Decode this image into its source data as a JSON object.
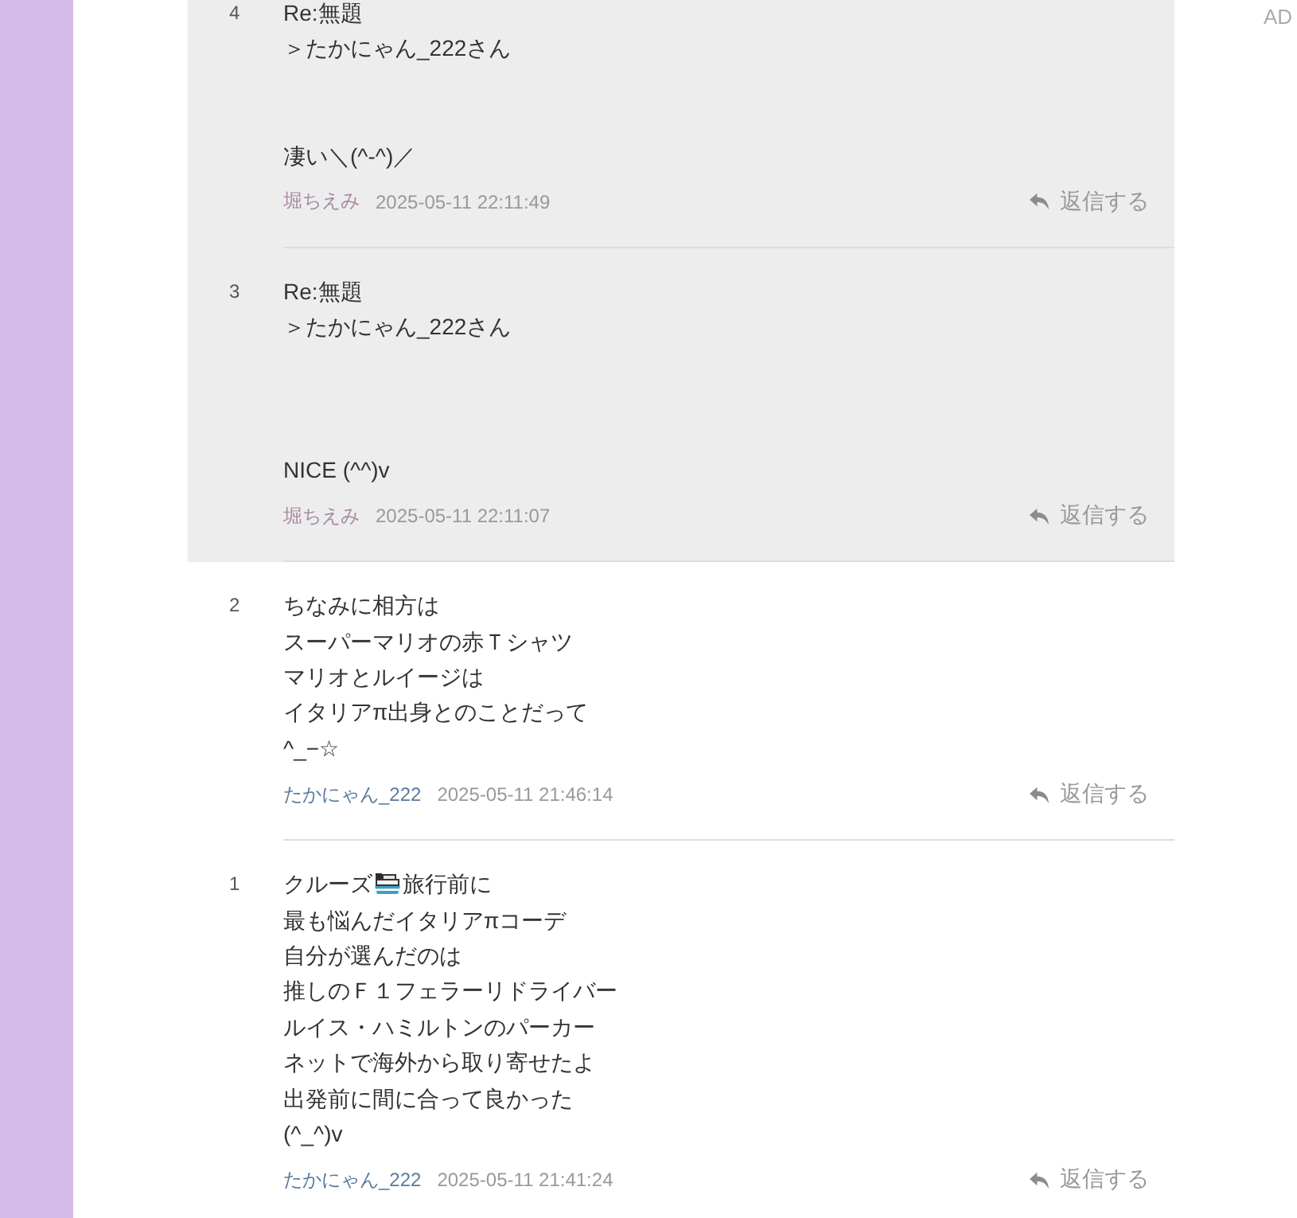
{
  "ad_label": "AD",
  "comments": [
    {
      "number": "4",
      "highlighted": true,
      "lines": [
        {
          "kind": "text",
          "text": "Re:無題"
        },
        {
          "kind": "text",
          "text": "＞たかにゃん_222さん"
        },
        {
          "kind": "blank"
        },
        {
          "kind": "blank"
        },
        {
          "kind": "text",
          "text": "凄い＼(^-^)／"
        }
      ],
      "author": "堀ちえみ",
      "color": "#a98aa3",
      "date": "2025-05-11 22:11:49",
      "reply": "返信する"
    },
    {
      "number": "3",
      "highlighted": true,
      "lines": [
        {
          "kind": "text",
          "text": "Re:無題"
        },
        {
          "kind": "text",
          "text": "＞たかにゃん_222さん"
        },
        {
          "kind": "blank"
        },
        {
          "kind": "blank"
        },
        {
          "kind": "blank"
        },
        {
          "kind": "text",
          "text": "NICE (^^)v"
        }
      ],
      "author": "堀ちえみ",
      "color": "#a98aa3",
      "date": "2025-05-11 22:11:07",
      "reply": "返信する"
    },
    {
      "number": "2",
      "highlighted": false,
      "lines": [
        {
          "kind": "text",
          "text": "ちなみに相方は"
        },
        {
          "kind": "text",
          "text": "スーパーマリオの赤Ｔシャツ"
        },
        {
          "kind": "text",
          "text": "マリオとルイージは"
        },
        {
          "kind": "text",
          "text": "イタリアπ出身とのことだって"
        },
        {
          "kind": "text",
          "text": "^_−☆"
        }
      ],
      "author": "たかにゃん_222",
      "color": "#557a9c",
      "date": "2025-05-11 21:46:14",
      "reply": "返信する"
    },
    {
      "number": "1",
      "highlighted": false,
      "lines": [
        {
          "kind": "emoji",
          "before": "クルーズ",
          "after": "旅行前に"
        },
        {
          "kind": "text",
          "text": "最も悩んだイタリアπコーデ"
        },
        {
          "kind": "text",
          "text": "自分が選んだのは"
        },
        {
          "kind": "text",
          "text": "推しのＦ１フェラーリドライバー"
        },
        {
          "kind": "text",
          "text": "ルイス・ハミルトンのパーカー"
        },
        {
          "kind": "text",
          "text": "ネットで海外から取り寄せたよ"
        },
        {
          "kind": "text",
          "text": "出発前に間に合って良かった"
        },
        {
          "kind": "text",
          "text": "(^_^)v"
        }
      ],
      "author": "たかにゃん_222",
      "color": "#557a9c",
      "date": "2025-05-11 21:41:24",
      "reply": "返信する"
    }
  ]
}
